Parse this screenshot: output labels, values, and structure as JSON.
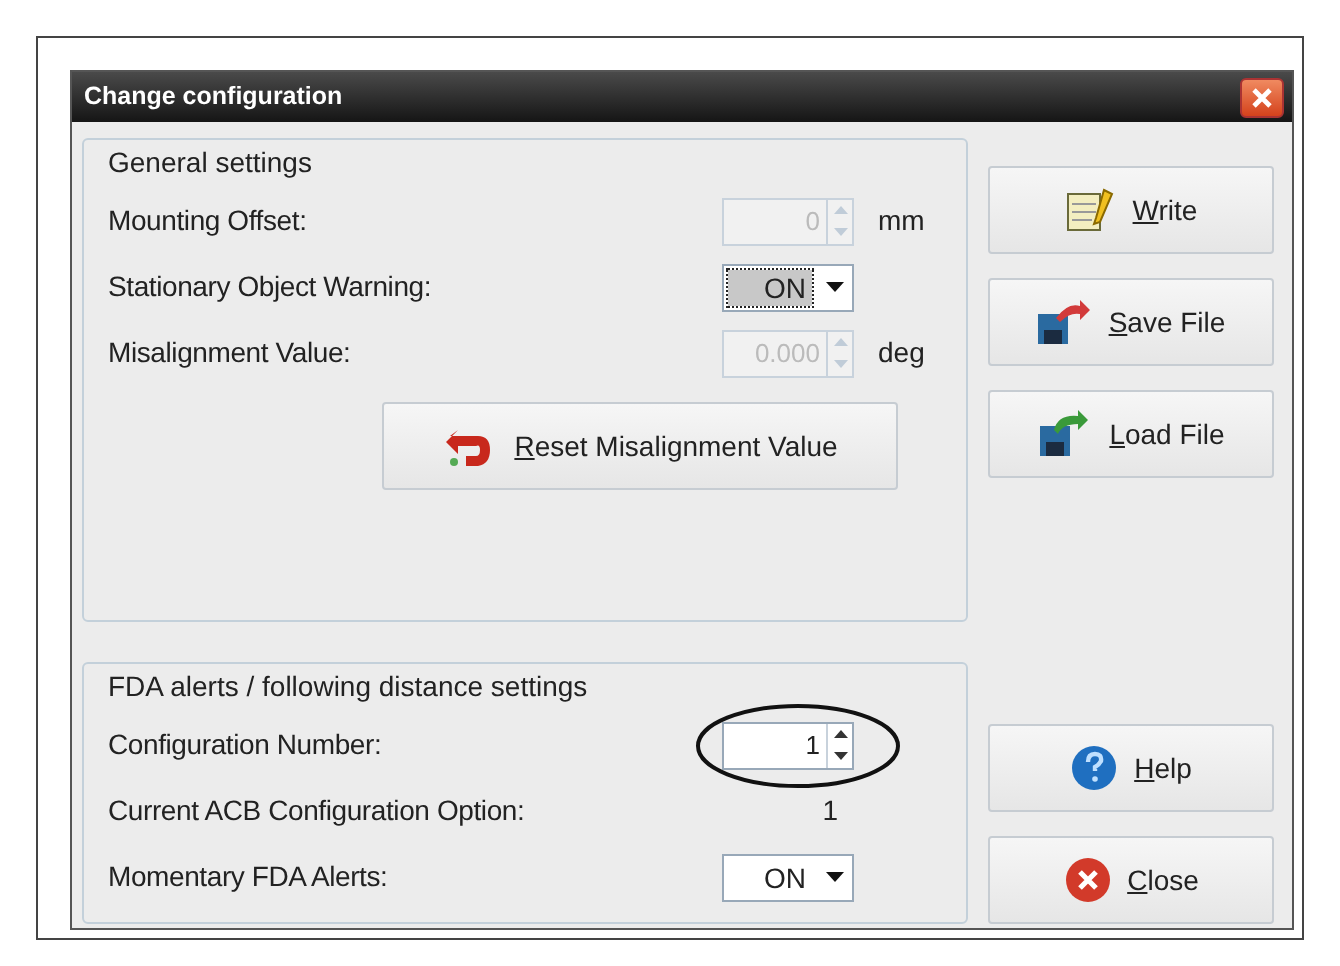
{
  "window": {
    "title": "Change configuration"
  },
  "general_settings": {
    "title": "General settings",
    "rows": [
      {
        "kind": "spinner",
        "label": "Mounting Offset:",
        "value": "0",
        "unit": "mm",
        "disabled": true
      },
      {
        "kind": "dropdown",
        "label": "Stationary Object Warning:",
        "value": "ON",
        "focused": true
      },
      {
        "kind": "spinner",
        "label": "Misalignment Value:",
        "value": "0.000",
        "unit": "deg",
        "disabled": true
      }
    ],
    "reset_button": "Reset Misalignment Value"
  },
  "fda_settings": {
    "title": "FDA alerts / following distance settings",
    "rows": [
      {
        "kind": "spinner",
        "label": "Configuration Number:",
        "value": "1",
        "disabled": false,
        "circled": true
      },
      {
        "kind": "readout",
        "label": "Current ACB Configuration Option:",
        "value": "1"
      },
      {
        "kind": "dropdown",
        "label": "Momentary FDA Alerts:",
        "value": "ON",
        "focused": false
      }
    ]
  },
  "top_buttons": [
    {
      "label": "Write",
      "kind": "write"
    },
    {
      "label": "Save File",
      "kind": "save"
    },
    {
      "label": "Load File",
      "kind": "load"
    }
  ],
  "bottom_buttons": [
    {
      "label": "Help",
      "kind": "help"
    },
    {
      "label": "Close",
      "kind": "close"
    }
  ]
}
